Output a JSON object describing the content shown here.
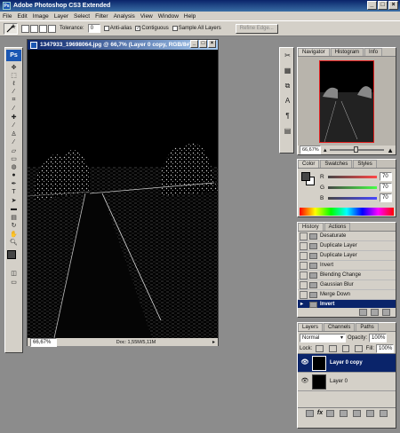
{
  "app": {
    "title": "Adobe Photoshop CS3 Extended",
    "ps_badge": "Ps"
  },
  "window_controls": {
    "minimize": "_",
    "maximize": "□",
    "close": "×"
  },
  "menu": [
    "File",
    "Edit",
    "Image",
    "Layer",
    "Select",
    "Filter",
    "Analysis",
    "View",
    "Window",
    "Help"
  ],
  "options": {
    "tolerance_label": "Tolerance:",
    "tolerance_value": "0",
    "antialias_label": "Anti-alias",
    "contiguous_label": "Contiguous",
    "sample_all_label": "Sample All Layers",
    "refine_edge_label": "Refine Edge..."
  },
  "document": {
    "title": "1347933_19698064.jpg @ 66,7% (Layer 0 copy, RGB/8#)",
    "zoom": "66,67%",
    "doc_info": "Doc: 1,55M/5,11M"
  },
  "navigator": {
    "tabs": [
      "Navigator",
      "Histogram",
      "Info"
    ],
    "zoom": "66,67%"
  },
  "color": {
    "tabs": [
      "Color",
      "Swatches",
      "Styles"
    ],
    "channels": [
      {
        "label": "R",
        "value": "70",
        "color": "#d00000"
      },
      {
        "label": "G",
        "value": "70",
        "color": "#00a000"
      },
      {
        "label": "B",
        "value": "70",
        "color": "#0000d0"
      }
    ]
  },
  "history": {
    "tabs": [
      "History",
      "Actions"
    ],
    "items": [
      "Desaturate",
      "Duplicate Layer",
      "Duplicate Layer",
      "Invert",
      "Blending Change",
      "Gaussian Blur",
      "Merge Down",
      "Invert"
    ]
  },
  "layers": {
    "tabs": [
      "Layers",
      "Channels",
      "Paths"
    ],
    "blend_mode": "Normal",
    "opacity_label": "Opacity:",
    "opacity_value": "100%",
    "lock_label": "Lock:",
    "fill_label": "Fill:",
    "fill_value": "100%",
    "items": [
      {
        "name": "Layer 0 copy",
        "selected": true
      },
      {
        "name": "Layer 0",
        "selected": false
      }
    ],
    "footer_icon": "fx"
  },
  "colors": {
    "accent": "#0a246a",
    "chrome": "#d4d0c8",
    "selection": "#0a246a"
  }
}
